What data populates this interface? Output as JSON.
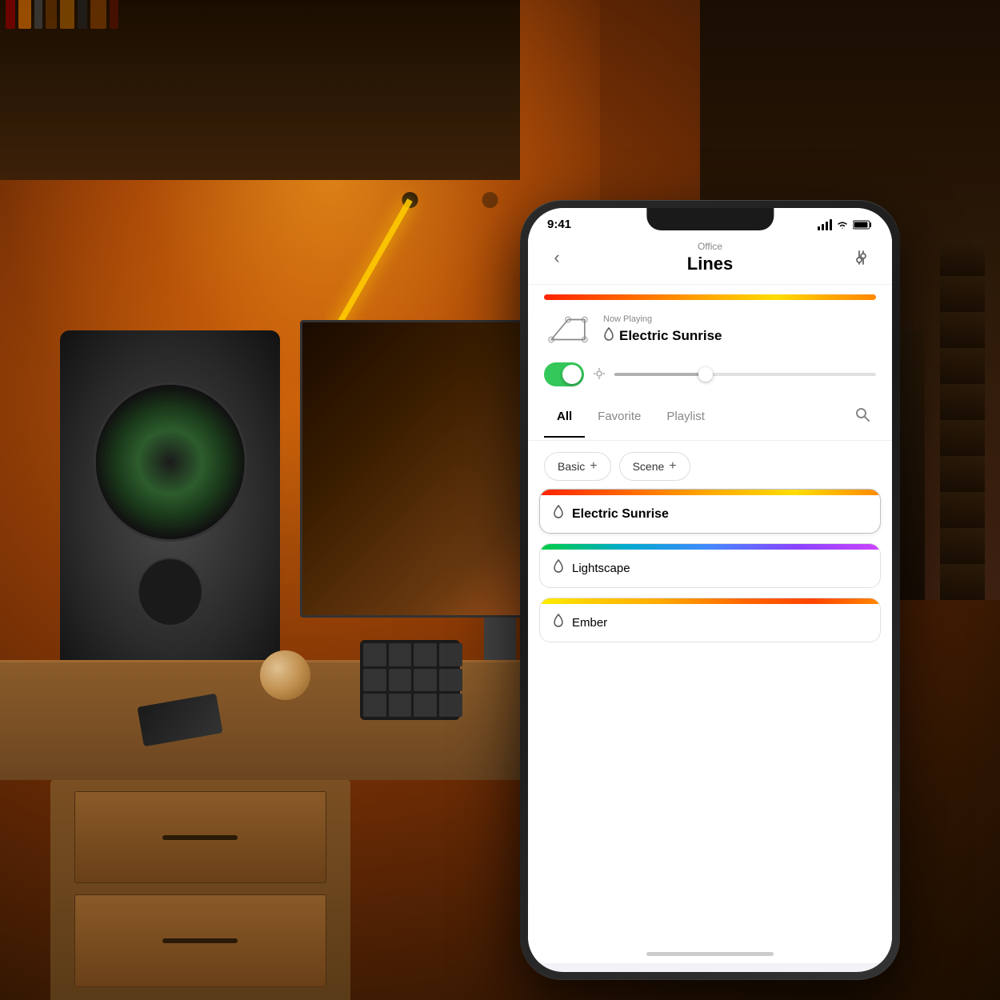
{
  "background": {
    "description": "Warm amber-lit home office with Nanoleaf Lines on wall"
  },
  "phone": {
    "status_bar": {
      "time": "9:41",
      "signal_label": "signal",
      "wifi_label": "wifi",
      "battery_label": "battery"
    },
    "header": {
      "back_label": "‹",
      "subtitle": "Office",
      "title": "Lines",
      "settings_icon": "⊕"
    },
    "color_bar": {
      "description": "orange-to-yellow gradient"
    },
    "now_playing": {
      "label": "Now Playing",
      "scene_name": "Electric Sunrise",
      "droplet": "○"
    },
    "controls": {
      "toggle_state": "on",
      "brightness_percent": 35
    },
    "tabs": {
      "all_label": "All",
      "favorite_label": "Favorite",
      "playlist_label": "Playlist",
      "search_label": "search",
      "active_tab": "All"
    },
    "scene_buttons": [
      {
        "label": "Basic",
        "plus": "+"
      },
      {
        "label": "Scene",
        "plus": "+"
      }
    ],
    "scenes": [
      {
        "name": "Electric Sunrise",
        "selected": true,
        "colors": [
          "#ff2200",
          "#ff8800",
          "#ffcc00",
          "#ffaa00",
          "#ff6600"
        ]
      },
      {
        "name": "Lightscape",
        "selected": false,
        "colors": [
          "#00cc44",
          "#00aacc",
          "#8844ff",
          "#cc44ff",
          "#ff44aa"
        ]
      },
      {
        "name": "Ember",
        "selected": false,
        "colors": [
          "#ffee00",
          "#ffaa00",
          "#ff6600",
          "#ff4400",
          "#ff8800"
        ]
      }
    ]
  }
}
